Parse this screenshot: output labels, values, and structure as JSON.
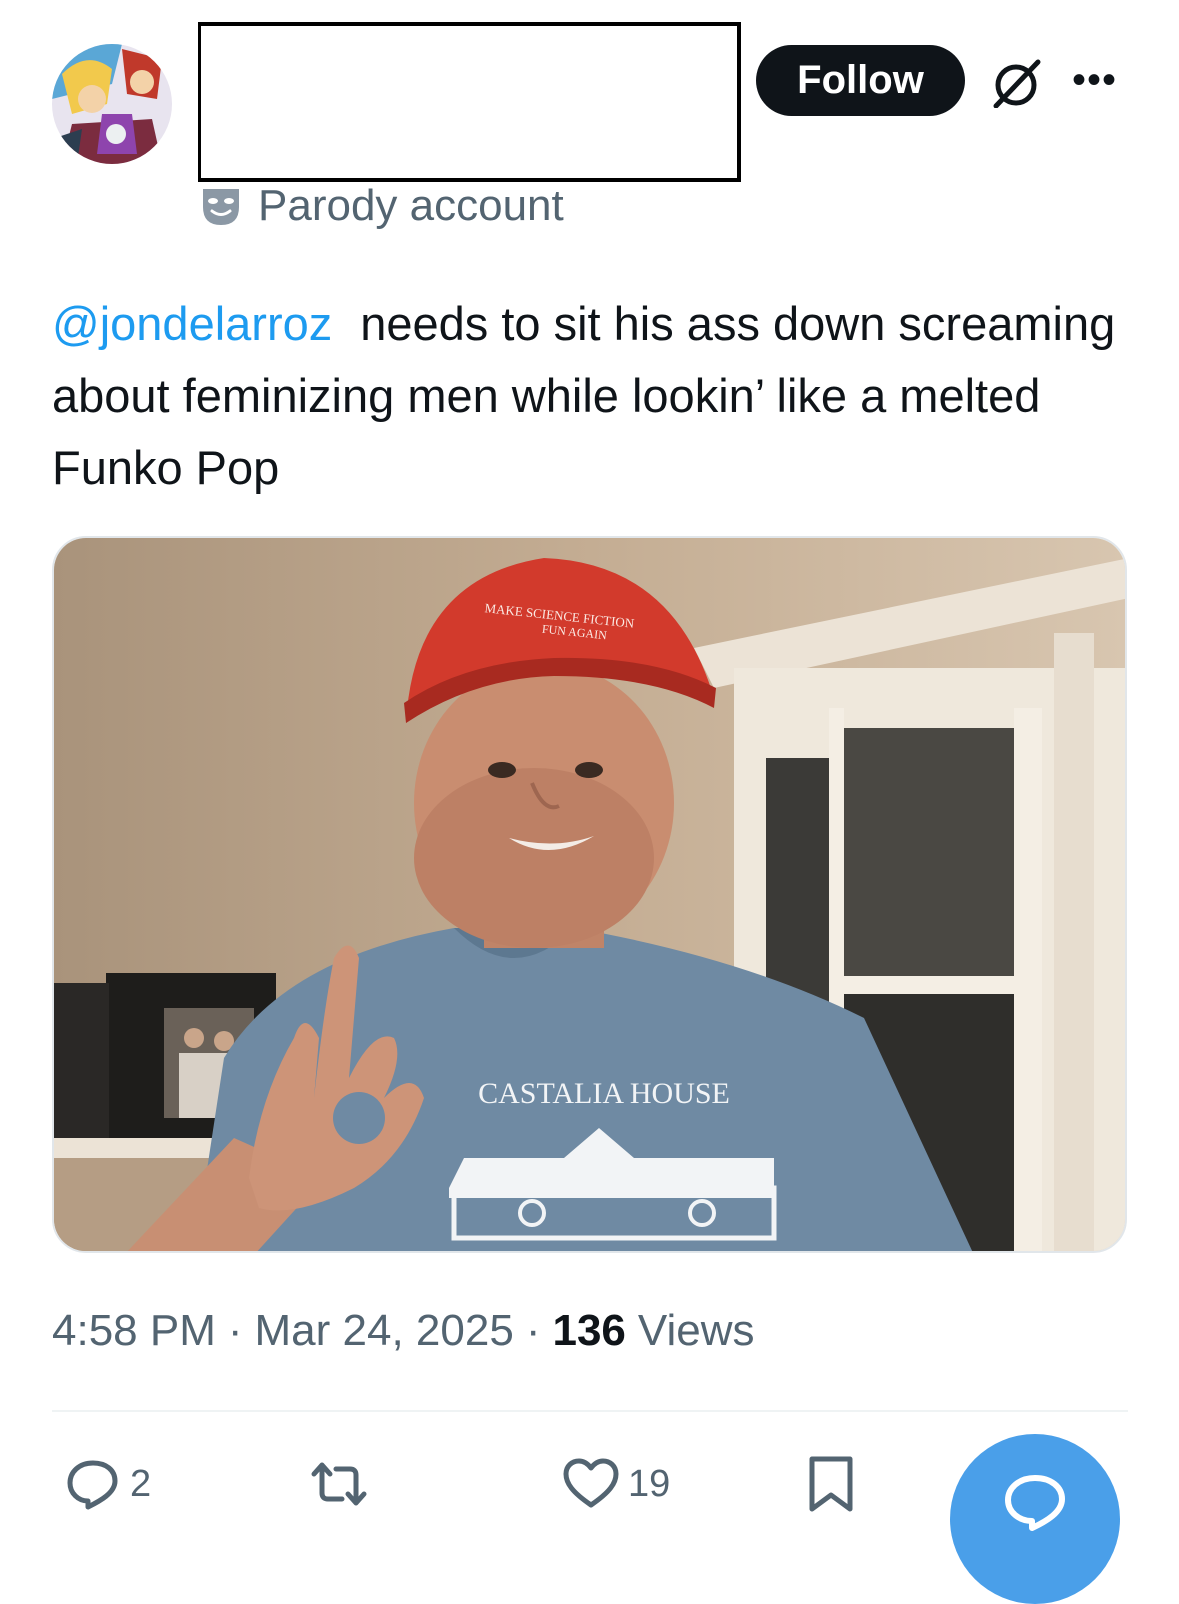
{
  "header": {
    "follow_label": "Follow",
    "more_label": "•••",
    "parody_label": "Parody account"
  },
  "tweet": {
    "mention": "@jondelarroz",
    "text": "needs to sit his ass down screaming about feminizing men while lookin’ like a melted Funko Pop"
  },
  "media": {
    "cap_text_line1": "MAKE SCIENCE FICTION",
    "cap_text_line2": "FUN AGAIN",
    "shirt_text": "CASTALIA HOUSE"
  },
  "meta": {
    "time": "4:58 PM",
    "separator": "·",
    "date": "Mar 24, 2025",
    "views_count": "136",
    "views_label": "Views"
  },
  "actions": {
    "reply_count": "2",
    "like_count": "19"
  },
  "colors": {
    "accent": "#1d9bf0",
    "fab": "#4a9fe9",
    "muted_text": "#536471",
    "button_dark": "#0f1419",
    "cap_red": "#d23a2c",
    "shirt_blue": "#6f8aa3"
  }
}
